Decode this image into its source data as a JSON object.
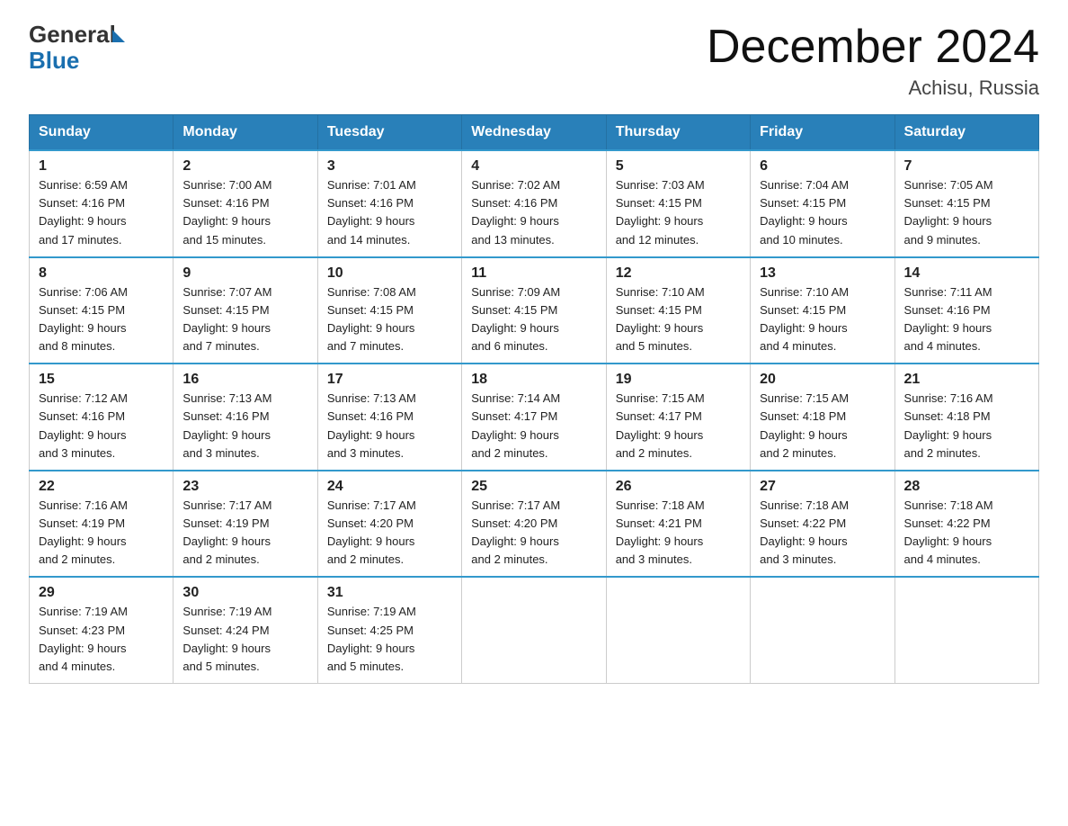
{
  "logo": {
    "general": "General",
    "blue": "Blue"
  },
  "title": "December 2024",
  "subtitle": "Achisu, Russia",
  "headers": [
    "Sunday",
    "Monday",
    "Tuesday",
    "Wednesday",
    "Thursday",
    "Friday",
    "Saturday"
  ],
  "weeks": [
    [
      {
        "day": "1",
        "sunrise": "6:59 AM",
        "sunset": "4:16 PM",
        "daylight": "9 hours and 17 minutes."
      },
      {
        "day": "2",
        "sunrise": "7:00 AM",
        "sunset": "4:16 PM",
        "daylight": "9 hours and 15 minutes."
      },
      {
        "day": "3",
        "sunrise": "7:01 AM",
        "sunset": "4:16 PM",
        "daylight": "9 hours and 14 minutes."
      },
      {
        "day": "4",
        "sunrise": "7:02 AM",
        "sunset": "4:16 PM",
        "daylight": "9 hours and 13 minutes."
      },
      {
        "day": "5",
        "sunrise": "7:03 AM",
        "sunset": "4:15 PM",
        "daylight": "9 hours and 12 minutes."
      },
      {
        "day": "6",
        "sunrise": "7:04 AM",
        "sunset": "4:15 PM",
        "daylight": "9 hours and 10 minutes."
      },
      {
        "day": "7",
        "sunrise": "7:05 AM",
        "sunset": "4:15 PM",
        "daylight": "9 hours and 9 minutes."
      }
    ],
    [
      {
        "day": "8",
        "sunrise": "7:06 AM",
        "sunset": "4:15 PM",
        "daylight": "9 hours and 8 minutes."
      },
      {
        "day": "9",
        "sunrise": "7:07 AM",
        "sunset": "4:15 PM",
        "daylight": "9 hours and 7 minutes."
      },
      {
        "day": "10",
        "sunrise": "7:08 AM",
        "sunset": "4:15 PM",
        "daylight": "9 hours and 7 minutes."
      },
      {
        "day": "11",
        "sunrise": "7:09 AM",
        "sunset": "4:15 PM",
        "daylight": "9 hours and 6 minutes."
      },
      {
        "day": "12",
        "sunrise": "7:10 AM",
        "sunset": "4:15 PM",
        "daylight": "9 hours and 5 minutes."
      },
      {
        "day": "13",
        "sunrise": "7:10 AM",
        "sunset": "4:15 PM",
        "daylight": "9 hours and 4 minutes."
      },
      {
        "day": "14",
        "sunrise": "7:11 AM",
        "sunset": "4:16 PM",
        "daylight": "9 hours and 4 minutes."
      }
    ],
    [
      {
        "day": "15",
        "sunrise": "7:12 AM",
        "sunset": "4:16 PM",
        "daylight": "9 hours and 3 minutes."
      },
      {
        "day": "16",
        "sunrise": "7:13 AM",
        "sunset": "4:16 PM",
        "daylight": "9 hours and 3 minutes."
      },
      {
        "day": "17",
        "sunrise": "7:13 AM",
        "sunset": "4:16 PM",
        "daylight": "9 hours and 3 minutes."
      },
      {
        "day": "18",
        "sunrise": "7:14 AM",
        "sunset": "4:17 PM",
        "daylight": "9 hours and 2 minutes."
      },
      {
        "day": "19",
        "sunrise": "7:15 AM",
        "sunset": "4:17 PM",
        "daylight": "9 hours and 2 minutes."
      },
      {
        "day": "20",
        "sunrise": "7:15 AM",
        "sunset": "4:18 PM",
        "daylight": "9 hours and 2 minutes."
      },
      {
        "day": "21",
        "sunrise": "7:16 AM",
        "sunset": "4:18 PM",
        "daylight": "9 hours and 2 minutes."
      }
    ],
    [
      {
        "day": "22",
        "sunrise": "7:16 AM",
        "sunset": "4:19 PM",
        "daylight": "9 hours and 2 minutes."
      },
      {
        "day": "23",
        "sunrise": "7:17 AM",
        "sunset": "4:19 PM",
        "daylight": "9 hours and 2 minutes."
      },
      {
        "day": "24",
        "sunrise": "7:17 AM",
        "sunset": "4:20 PM",
        "daylight": "9 hours and 2 minutes."
      },
      {
        "day": "25",
        "sunrise": "7:17 AM",
        "sunset": "4:20 PM",
        "daylight": "9 hours and 2 minutes."
      },
      {
        "day": "26",
        "sunrise": "7:18 AM",
        "sunset": "4:21 PM",
        "daylight": "9 hours and 3 minutes."
      },
      {
        "day": "27",
        "sunrise": "7:18 AM",
        "sunset": "4:22 PM",
        "daylight": "9 hours and 3 minutes."
      },
      {
        "day": "28",
        "sunrise": "7:18 AM",
        "sunset": "4:22 PM",
        "daylight": "9 hours and 4 minutes."
      }
    ],
    [
      {
        "day": "29",
        "sunrise": "7:19 AM",
        "sunset": "4:23 PM",
        "daylight": "9 hours and 4 minutes."
      },
      {
        "day": "30",
        "sunrise": "7:19 AM",
        "sunset": "4:24 PM",
        "daylight": "9 hours and 5 minutes."
      },
      {
        "day": "31",
        "sunrise": "7:19 AM",
        "sunset": "4:25 PM",
        "daylight": "9 hours and 5 minutes."
      },
      null,
      null,
      null,
      null
    ]
  ]
}
